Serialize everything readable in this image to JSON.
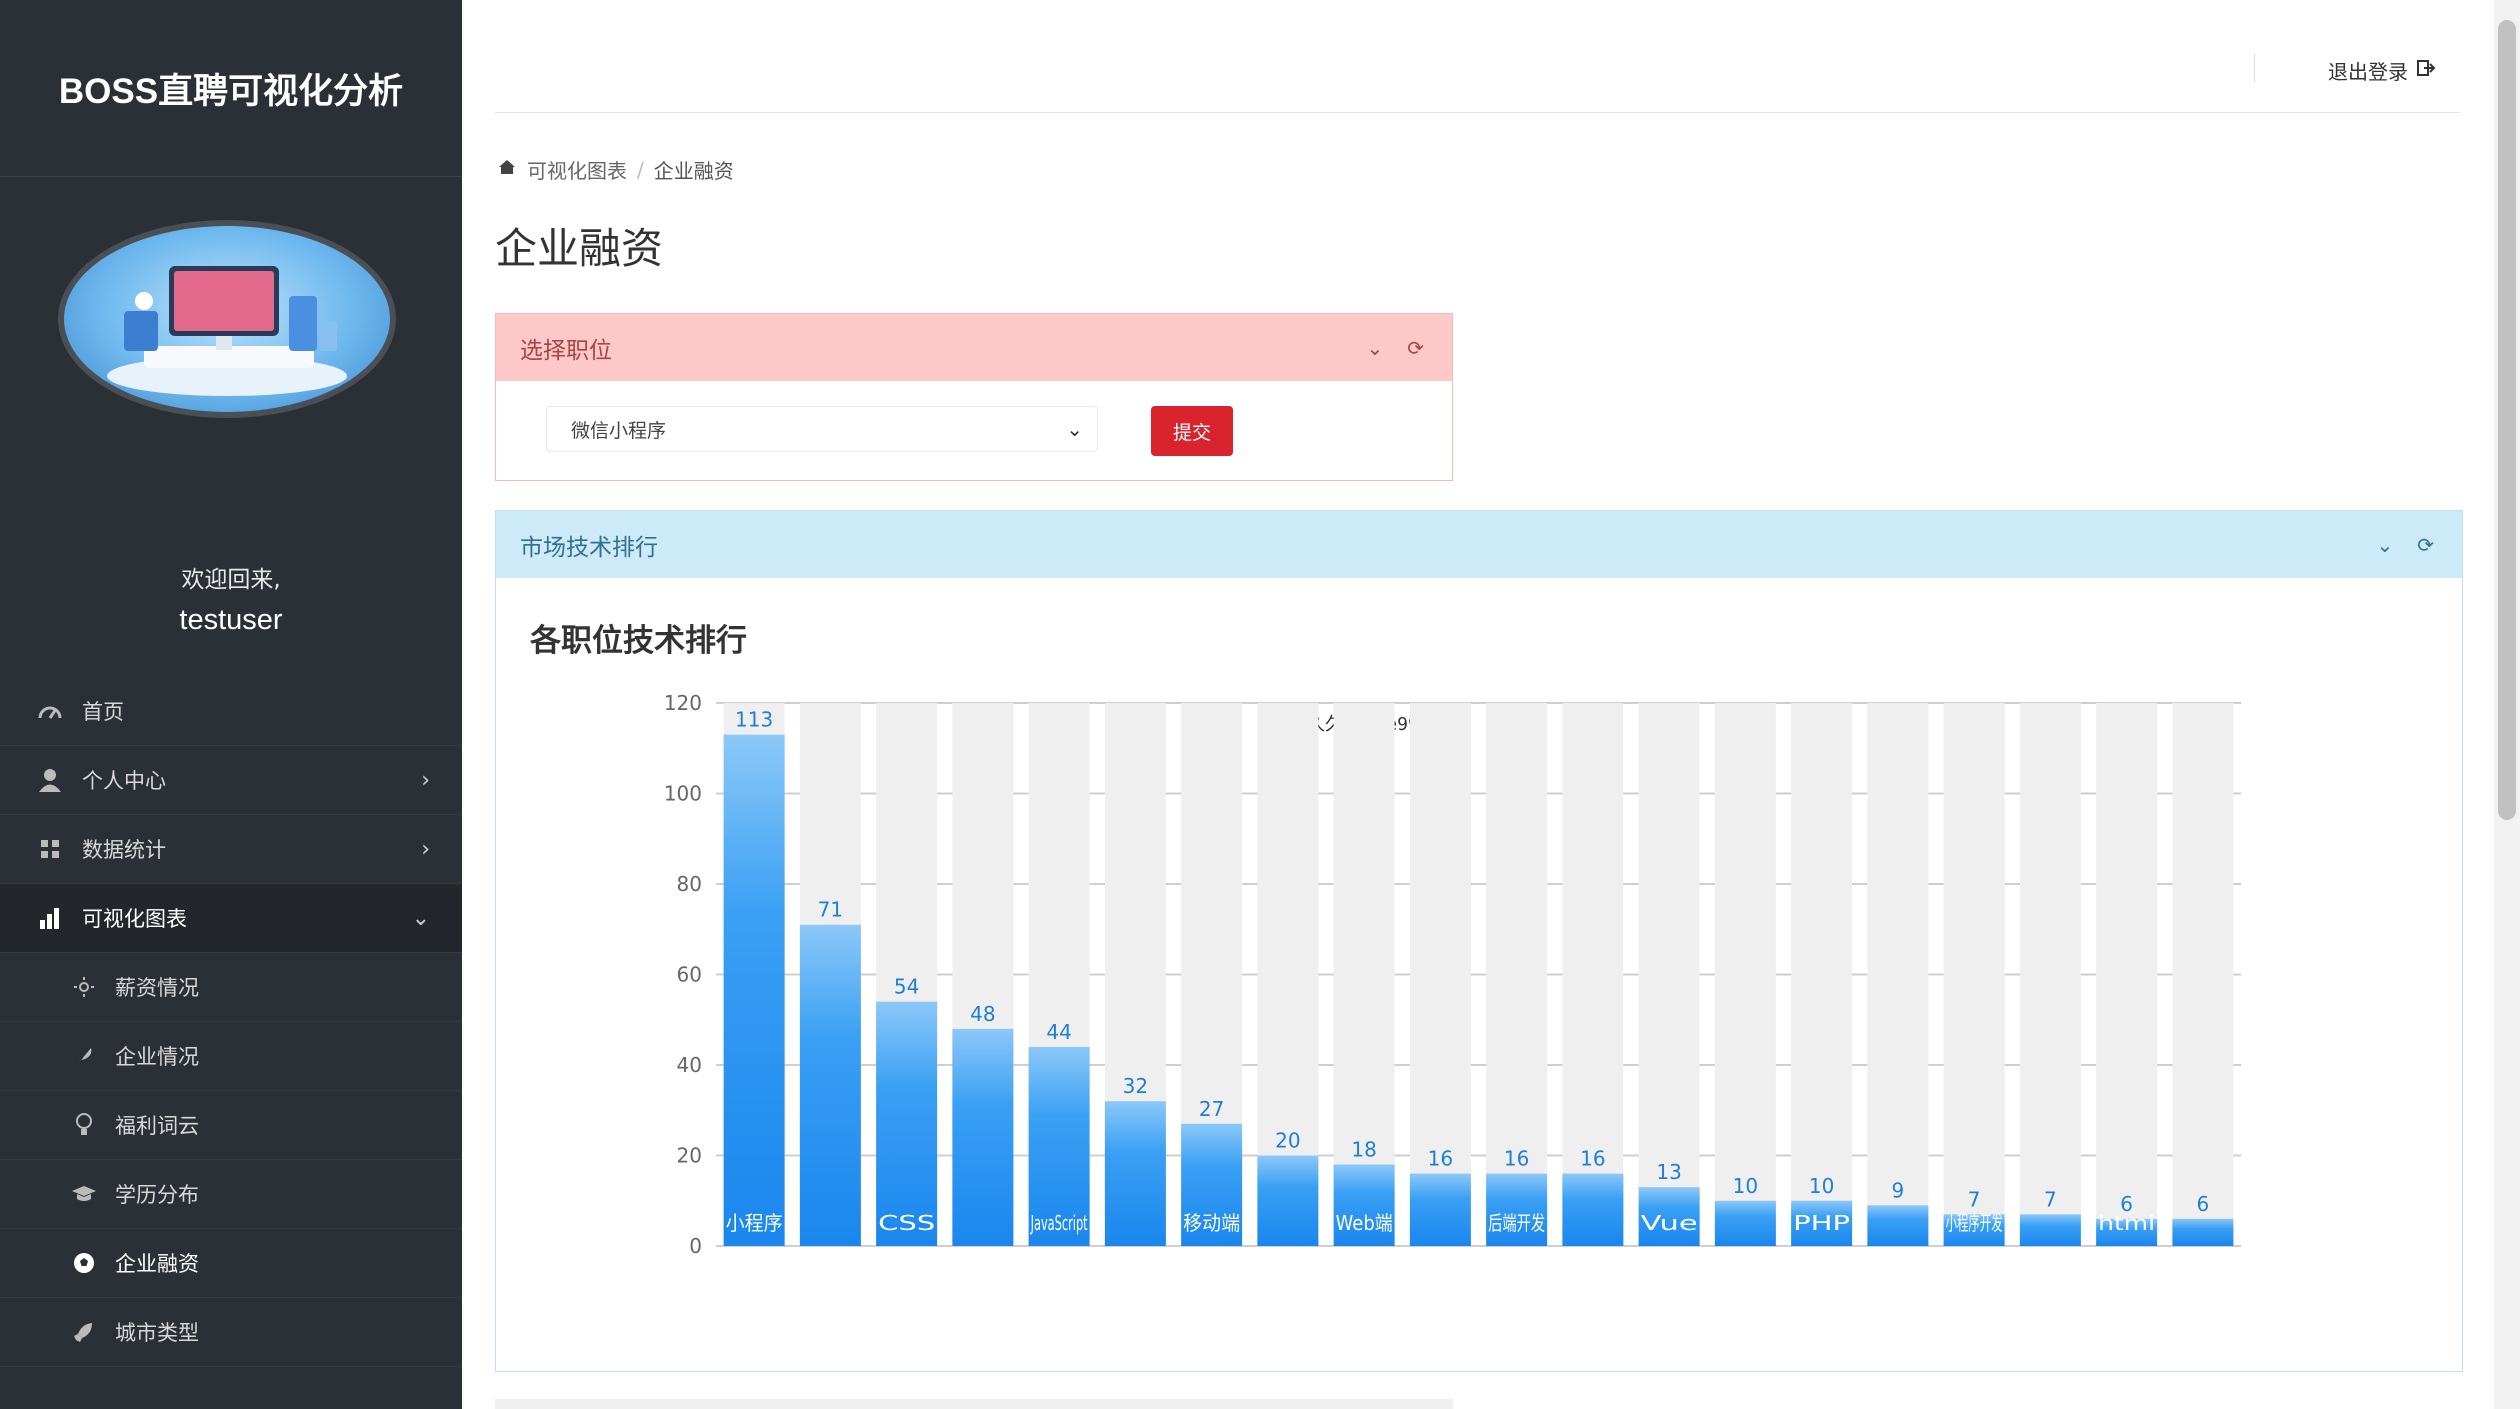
{
  "sidebar": {
    "brand": "BOSS直聘可视化分析",
    "welcome_line1": "欢迎回来,",
    "username": "testuser",
    "items": [
      {
        "label": "首页",
        "icon": "dashboard-icon"
      },
      {
        "label": "个人中心",
        "icon": "user-icon"
      },
      {
        "label": "数据统计",
        "icon": "grid-icon"
      },
      {
        "label": "可视化图表",
        "icon": "bar-chart-icon"
      },
      {
        "label": "薪资情况",
        "icon": "sun-icon"
      },
      {
        "label": "企业情况",
        "icon": "feather-icon"
      },
      {
        "label": "福利词云",
        "icon": "lightbulb-icon"
      },
      {
        "label": "学历分布",
        "icon": "graduation-cap-icon"
      },
      {
        "label": "企业融资",
        "icon": "soccer-ball-icon"
      },
      {
        "label": "城市类型",
        "icon": "rocket-icon"
      }
    ]
  },
  "header": {
    "logout_label": "退出登录"
  },
  "breadcrumb": {
    "parent": "可视化图表",
    "current": "企业融资"
  },
  "page_title": "企业融资",
  "select_panel": {
    "title": "选择职位",
    "selected_value": "微信小程序",
    "submit_label": "提交"
  },
  "chart_panel": {
    "title": "市场技术排行"
  },
  "colors": {
    "sidebar_bg": "#2b3036",
    "bar_blue": "#1f8cf0",
    "submit_red": "#d9232d"
  },
  "chart_data": {
    "type": "bar",
    "title": "各职位技术排行",
    "subtitle": "源码久久-code99.top",
    "categories": [
      "小程序",
      "",
      "CSS",
      "",
      "JavaScript",
      "",
      "移动端",
      "",
      "Web端",
      "",
      "后端开发",
      "",
      "Vue",
      "",
      "PHP",
      "",
      "小程序开发",
      "",
      "html",
      ""
    ],
    "values": [
      113,
      71,
      54,
      48,
      44,
      32,
      27,
      20,
      18,
      16,
      16,
      16,
      13,
      10,
      10,
      9,
      7,
      7,
      6,
      6
    ],
    "ylim": [
      0,
      120
    ],
    "yticks": [
      0,
      20,
      40,
      60,
      80,
      100,
      120
    ],
    "grid": true,
    "background_bars": true
  }
}
